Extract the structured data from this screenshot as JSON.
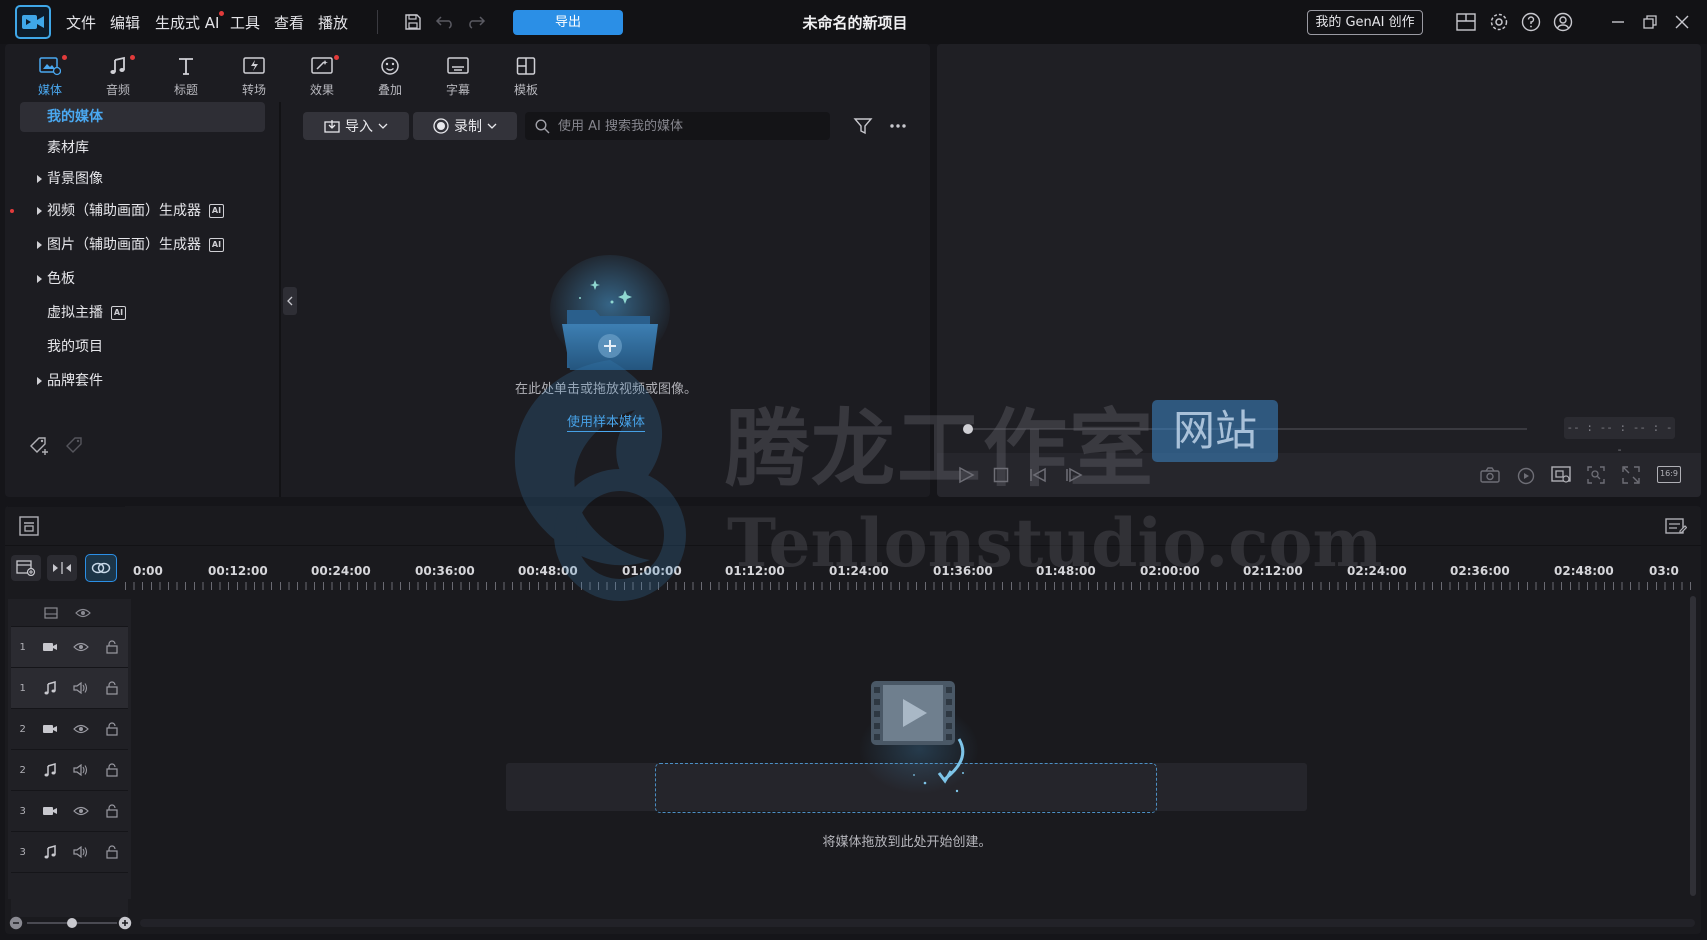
{
  "app": {
    "menu": [
      "文件",
      "编辑",
      "生成式 AI",
      "工具",
      "查看",
      "播放"
    ],
    "export_label": "导出",
    "project_title": "未命名的新项目",
    "genai_label": "我的 GenAI 创作"
  },
  "tabs": [
    "媒体",
    "音频",
    "标题",
    "转场",
    "效果",
    "叠加",
    "字幕",
    "模板"
  ],
  "sidebar": {
    "items": [
      "我的媒体",
      "素材库",
      "背景图像",
      "视频（辅助画面）生成器",
      "图片（辅助画面）生成器",
      "色板",
      "虚拟主播",
      "我的项目",
      "品牌套件"
    ],
    "ai_badge": "AI"
  },
  "media": {
    "import_label": "导入",
    "record_label": "录制",
    "search_placeholder": "使用 AI 搜索我的媒体",
    "empty_text": "在此处单击或拖放视频或图像。",
    "sample_link": "使用样本媒体"
  },
  "preview": {
    "timecode": "-- : -- : -- : --",
    "aspect_ratio": "16:9"
  },
  "timeline": {
    "ticks": [
      "0:00",
      "00:12:00",
      "00:24:00",
      "00:36:00",
      "00:48:00",
      "01:00:00",
      "01:12:00",
      "01:24:00",
      "01:36:00",
      "01:48:00",
      "02:00:00",
      "02:12:00",
      "02:24:00",
      "02:36:00",
      "02:48:00",
      "03:0"
    ],
    "track_numbers": [
      "1",
      "1",
      "2",
      "2",
      "3",
      "3"
    ],
    "drop_text": "将媒体拖放到此处开始创建。"
  },
  "watermark": {
    "cn": "腾龙工作室",
    "badge": "网站",
    "en": "Tenlonstudio.com"
  },
  "colors": {
    "accent": "#2b8fe6",
    "accent_text": "#4aa8f0",
    "notify_dot": "#e23b3b"
  }
}
